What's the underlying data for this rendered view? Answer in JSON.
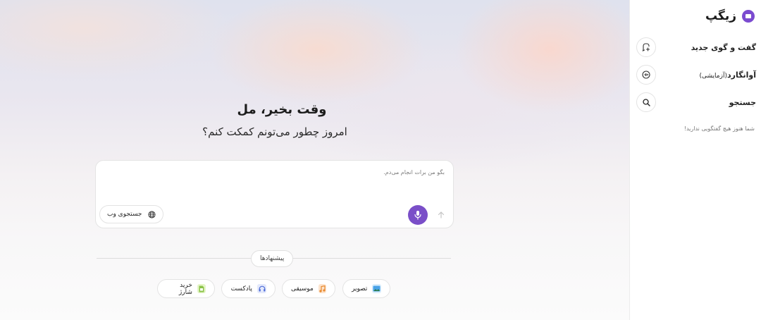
{
  "app": {
    "name": "زیگپ"
  },
  "sidebar": {
    "new_chat": "گفت و گوی جدید",
    "avangard": "آوانگارد",
    "avangard_tag": "(آزمایشی)",
    "search": "جستجو",
    "empty_text": "شما هنوز هیچ گفتگویی ندارید!"
  },
  "greeting": {
    "title": "وقت بخیر، مل",
    "subtitle": "امروز چطور می‌تونم کمکت کنم؟"
  },
  "prompt": {
    "placeholder": "بگو من برات انجام می‌دم.",
    "web_search": "جستجوی وب"
  },
  "suggestions": {
    "label": "پیشنهادها",
    "chips": [
      {
        "label": "تصویر",
        "icon": "image-icon"
      },
      {
        "label": "موسیقی",
        "icon": "music-icon"
      },
      {
        "label": "پادکست",
        "icon": "headphones-icon"
      },
      {
        "label": "خرید شارژ",
        "icon": "sim-card-icon"
      }
    ]
  },
  "colors": {
    "accent": "#7a4fc8"
  }
}
